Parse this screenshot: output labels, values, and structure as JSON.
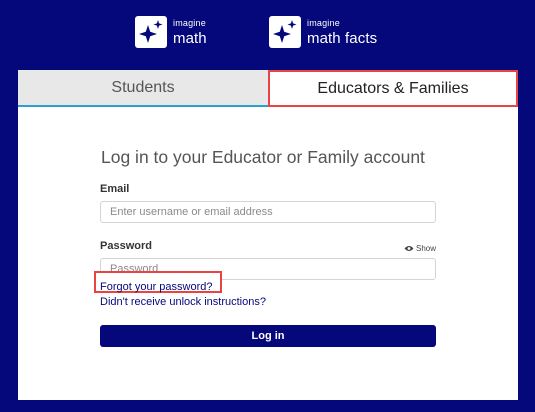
{
  "logos": [
    {
      "small": "imagine",
      "big": "math",
      "icon": "sparkle-icon"
    },
    {
      "small": "imagine",
      "big": "math facts",
      "icon": "sparkle-icon"
    }
  ],
  "tabs": {
    "students": "Students",
    "educators": "Educators & Families"
  },
  "form": {
    "heading": "Log in to your Educator or Family account",
    "email_label": "Email",
    "email_placeholder": "Enter username or email address",
    "email_value": "",
    "password_label": "Password",
    "password_placeholder": "Password",
    "password_value": "",
    "show_label": "Show",
    "forgot_link": "Forgot your password?",
    "unlock_link": "Didn't receive unlock instructions?",
    "login_button": "Log in"
  },
  "colors": {
    "brand_navy": "#05087a",
    "highlight_red": "#e84444",
    "tab_accent": "#2b9fd1"
  }
}
